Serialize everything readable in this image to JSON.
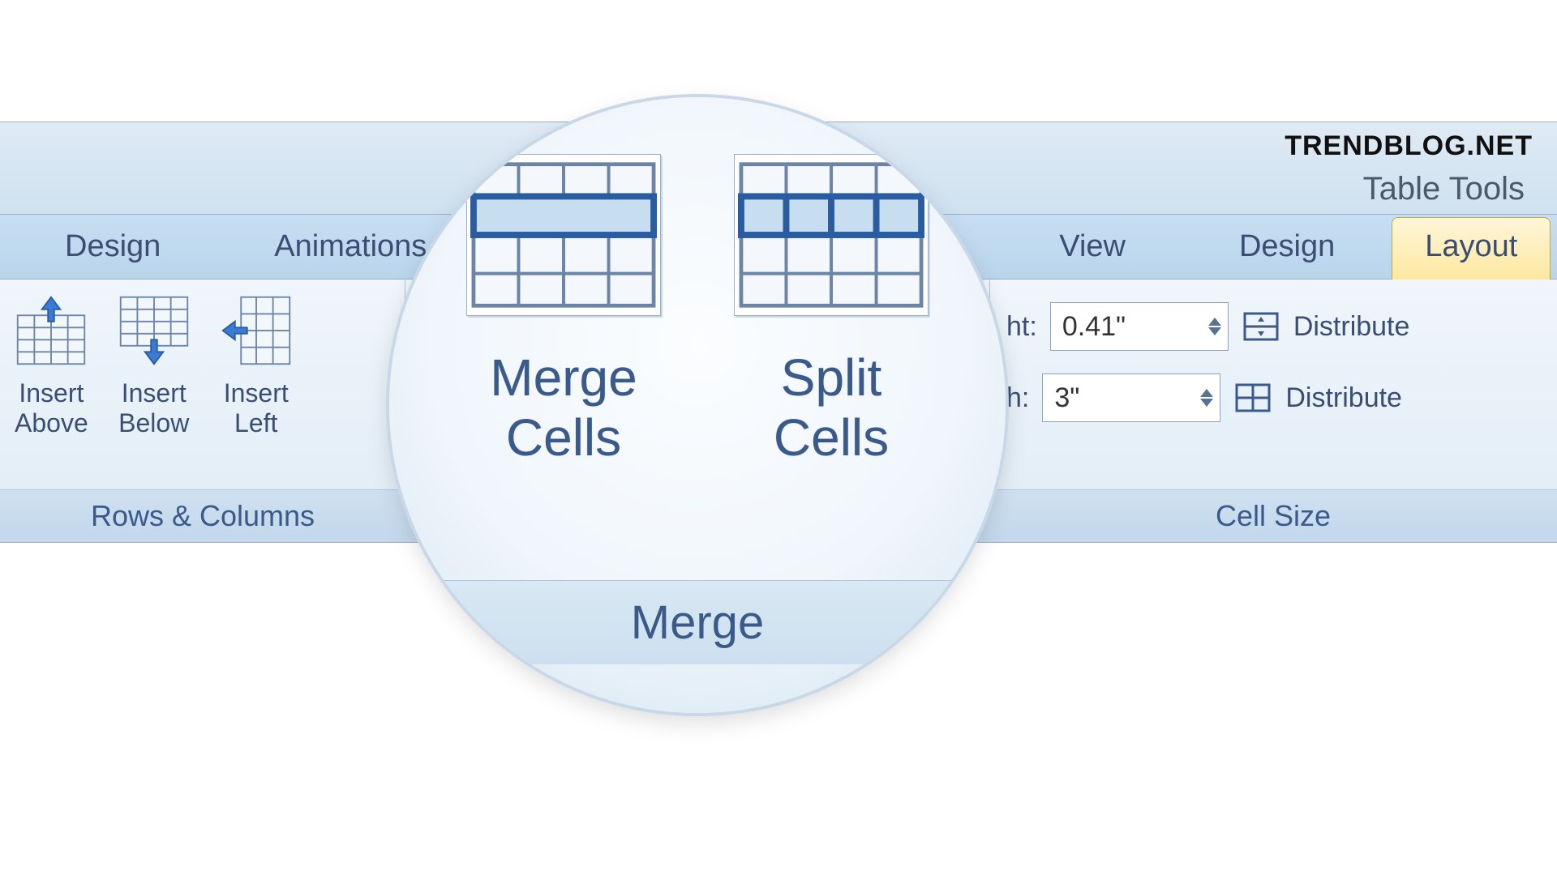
{
  "watermark": "TRENDBLOG.NET",
  "contextual_tab_title": "Table Tools",
  "tabs": {
    "design": "Design",
    "animations": "Animations",
    "view": "View",
    "tt_design": "Design",
    "tt_layout": "Layout"
  },
  "rows_columns": {
    "insert_above": "Insert\nAbove",
    "insert_below": "Insert\nBelow",
    "insert_left": "Insert\nLeft",
    "group_label": "Rows & Columns"
  },
  "merge": {
    "merge_cells": "Merge\nCells",
    "split_cells": "Split\nCells",
    "group_label": "Merge"
  },
  "cell_size": {
    "height_label_partial": "ht:",
    "height_value": "0.41\"",
    "width_label_partial": "h:",
    "width_value": "3\"",
    "distribute_rows": "Distribute",
    "distribute_cols": "Distribute",
    "group_label": "Cell Size"
  }
}
